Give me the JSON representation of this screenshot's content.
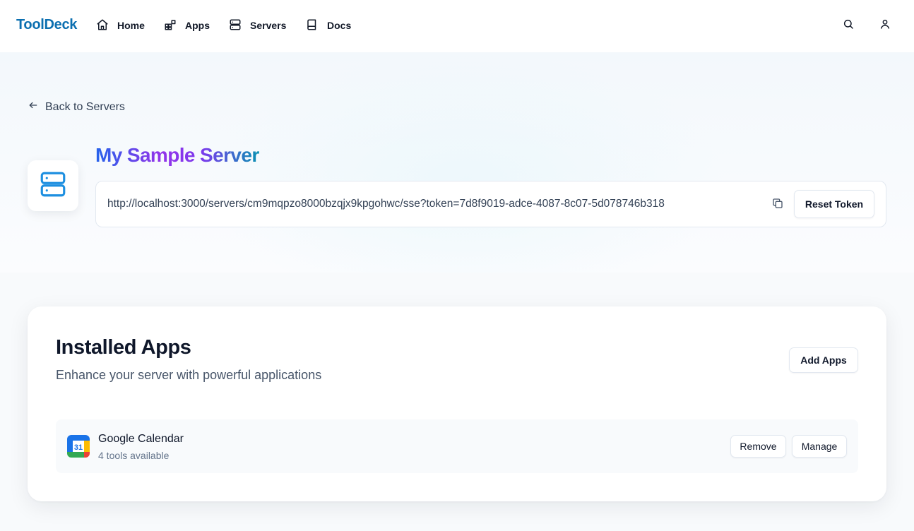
{
  "nav": {
    "brand": "ToolDeck",
    "items": [
      {
        "label": "Home",
        "icon": "home-icon"
      },
      {
        "label": "Apps",
        "icon": "apps-icon"
      },
      {
        "label": "Servers",
        "icon": "server-icon"
      },
      {
        "label": "Docs",
        "icon": "book-icon"
      }
    ],
    "actions": [
      "search-icon",
      "user-icon"
    ]
  },
  "hero": {
    "back_label": "Back to Servers",
    "server_name": "My Sample Server",
    "server_icon": "server-icon",
    "url": "http://localhost:3000/servers/cm9mqpzo8000bzqjx9kpgohwc/sse?token=7d8f9019-adce-4087-8c07-5d078746b318",
    "copy_icon": "copy-icon",
    "reset_label": "Reset Token",
    "title_gradient": [
      "#2563eb",
      "#9333ea",
      "#7c3aed",
      "#0891b2"
    ]
  },
  "installed": {
    "title": "Installed Apps",
    "subtitle": "Enhance your server with powerful applications",
    "add_label": "Add Apps",
    "apps": [
      {
        "name": "Google Calendar",
        "meta": "4 tools available",
        "logo_text": "31",
        "remove_label": "Remove",
        "manage_label": "Manage"
      }
    ]
  },
  "colors": {
    "brand": "#0b6fb0",
    "icon_accent": "#1d8fe0"
  }
}
